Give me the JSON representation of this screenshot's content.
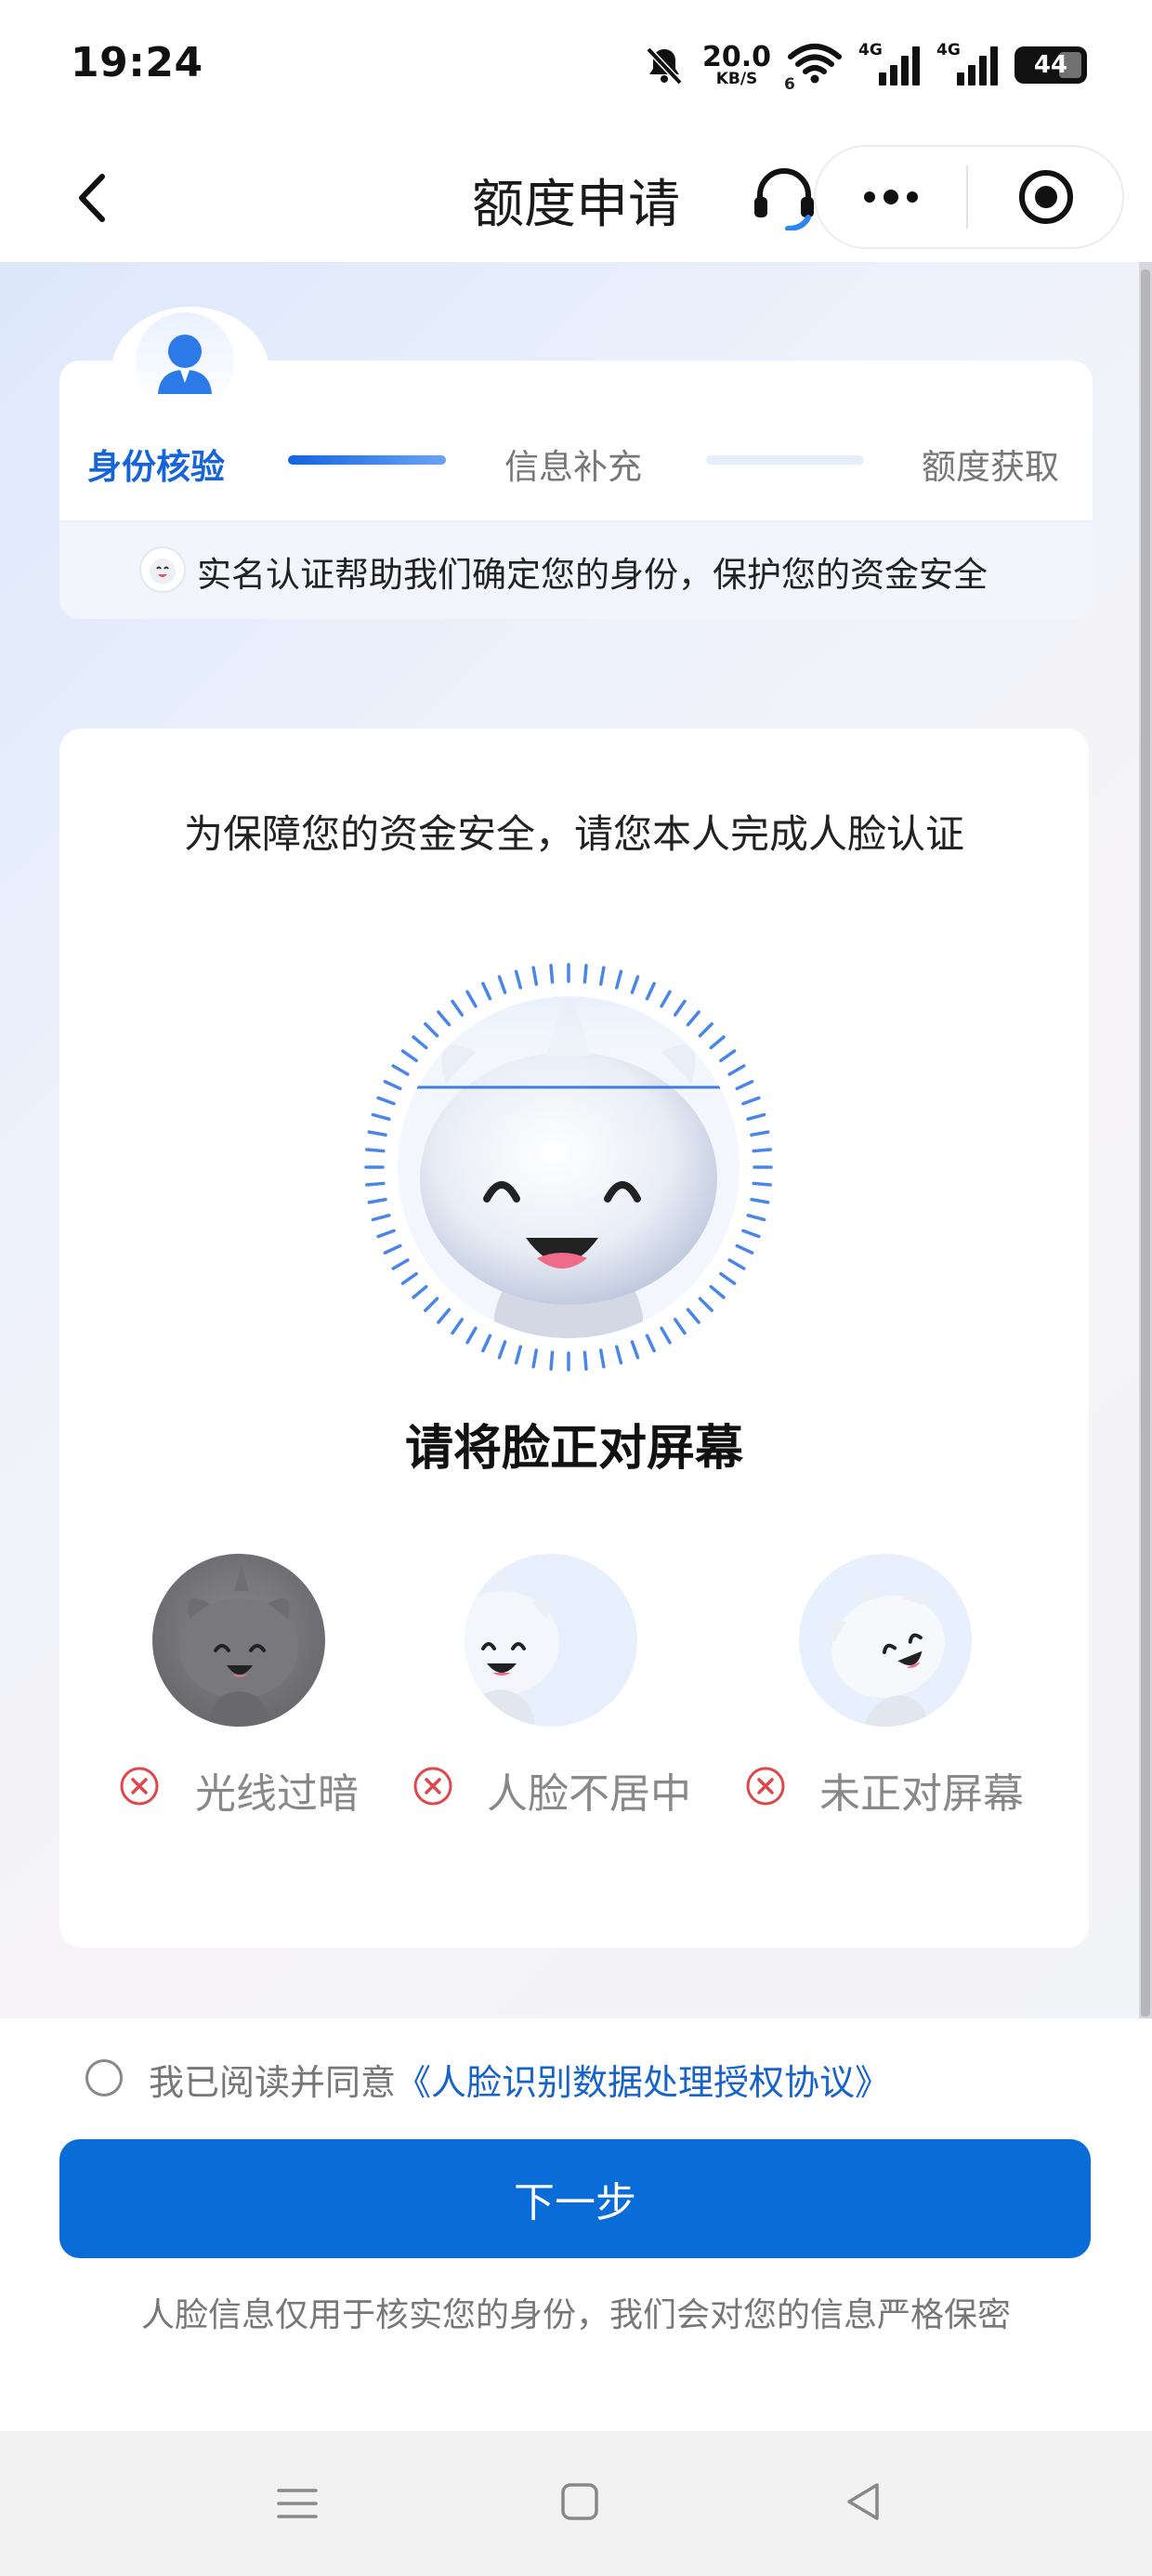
{
  "status_bar": {
    "time": "19:24",
    "net_speed_value": "20.0",
    "net_speed_unit": "KB/S",
    "wifi_badge": "6",
    "signal_label_1": "4G",
    "signal_label_2": "4G",
    "battery_level": "44"
  },
  "nav": {
    "title": "额度申请",
    "icons": [
      "back-icon",
      "headset-icon",
      "more-icon",
      "target-icon"
    ]
  },
  "steps": {
    "items": [
      {
        "label": "身份核验",
        "state": "active"
      },
      {
        "label": "信息补充",
        "state": "pending"
      },
      {
        "label": "额度获取",
        "state": "pending"
      }
    ],
    "tip": "实名认证帮助我们确定您的身份，保护您的资金安全"
  },
  "face": {
    "title": "为保障您的资金安全，请您本人完成人脸认证",
    "hint": "请将脸正对屏幕",
    "examples": [
      {
        "label": "光线过暗"
      },
      {
        "label": "人脸不居中"
      },
      {
        "label": "未正对屏幕"
      }
    ]
  },
  "agreement": {
    "prefix": "我已阅读并同意",
    "link": "《人脸识别数据处理授权协议》",
    "checked": false
  },
  "next_button": "下一步",
  "privacy_note": "人脸信息仅用于核实您的身份，我们会对您的信息严格保密",
  "colors": {
    "primary": "#0a6cd6",
    "step_active": "#1565d8",
    "link": "#1763c9",
    "error": "#e0474c"
  }
}
